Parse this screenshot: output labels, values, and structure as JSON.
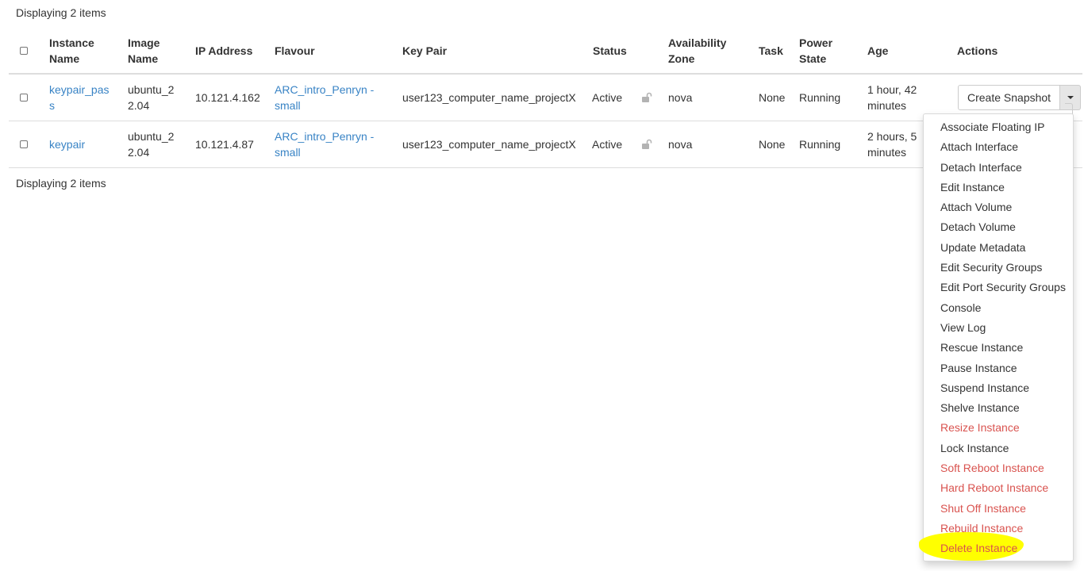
{
  "summary": "Displaying 2 items",
  "headers": {
    "instance_name": "Instance Name",
    "image_name": "Image Name",
    "ip_address": "IP Address",
    "flavour": "Flavour",
    "key_pair": "Key Pair",
    "status": "Status",
    "availability_zone": "Availability Zone",
    "task": "Task",
    "power_state": "Power State",
    "age": "Age",
    "actions": "Actions"
  },
  "rows": [
    {
      "instance_name": "keypair_pass",
      "image_name": "ubuntu_22.04",
      "ip_address": "10.121.4.162",
      "flavour": "ARC_intro_Penryn - small",
      "key_pair": "user123_computer_name_projectX",
      "status": "Active",
      "availability_zone": "nova",
      "task": "None",
      "power_state": "Running",
      "age": "1 hour, 42 minutes",
      "action_label": "Create Snapshot"
    },
    {
      "instance_name": "keypair",
      "image_name": "ubuntu_22.04",
      "ip_address": "10.121.4.87",
      "flavour": "ARC_intro_Penryn - small",
      "key_pair": "user123_computer_name_projectX",
      "status": "Active",
      "availability_zone": "nova",
      "task": "None",
      "power_state": "Running",
      "age": "2 hours, 5 minutes"
    }
  ],
  "menu": [
    {
      "label": "Associate Floating IP",
      "danger": false
    },
    {
      "label": "Attach Interface",
      "danger": false
    },
    {
      "label": "Detach Interface",
      "danger": false
    },
    {
      "label": "Edit Instance",
      "danger": false
    },
    {
      "label": "Attach Volume",
      "danger": false
    },
    {
      "label": "Detach Volume",
      "danger": false
    },
    {
      "label": "Update Metadata",
      "danger": false
    },
    {
      "label": "Edit Security Groups",
      "danger": false
    },
    {
      "label": "Edit Port Security Groups",
      "danger": false
    },
    {
      "label": "Console",
      "danger": false
    },
    {
      "label": "View Log",
      "danger": false
    },
    {
      "label": "Rescue Instance",
      "danger": false
    },
    {
      "label": "Pause Instance",
      "danger": false
    },
    {
      "label": "Suspend Instance",
      "danger": false
    },
    {
      "label": "Shelve Instance",
      "danger": false
    },
    {
      "label": "Resize Instance",
      "danger": true
    },
    {
      "label": "Lock Instance",
      "danger": false
    },
    {
      "label": "Soft Reboot Instance",
      "danger": true
    },
    {
      "label": "Hard Reboot Instance",
      "danger": true
    },
    {
      "label": "Shut Off Instance",
      "danger": true
    },
    {
      "label": "Rebuild Instance",
      "danger": true
    },
    {
      "label": "Delete Instance",
      "danger": true,
      "highlighted": true
    }
  ],
  "colors": {
    "link": "#3883c5",
    "danger": "#d9534f",
    "highlight": "#ffff00",
    "text": "#333333"
  },
  "icons": {
    "status_lock": "unlocked-padlock-icon",
    "dropdown": "caret-down-icon"
  }
}
